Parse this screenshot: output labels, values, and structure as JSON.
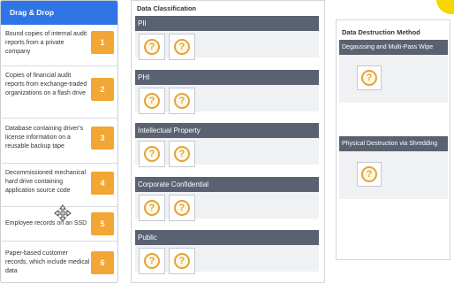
{
  "drag_drop": {
    "title": "Drag & Drop",
    "items": [
      {
        "text": "Bound copies of internal audit reports from a private company",
        "number": "1"
      },
      {
        "text": "Copies of financial audit reports from exchange-traded organizations on a flash drive",
        "number": "2"
      },
      {
        "text": "Database containing driver's license information on a reusable backup tape",
        "number": "3"
      },
      {
        "text": "Decommissioned mechanical hard drive containing application source code",
        "number": "4"
      },
      {
        "text": "Employee records on an SSD",
        "number": "5"
      },
      {
        "text": "Paper-based customer records, which include medical data",
        "number": "6"
      }
    ],
    "badge_color": "#f2a634"
  },
  "classification": {
    "title": "Data Classification",
    "categories": [
      {
        "label": "PII"
      },
      {
        "label": "PHI"
      },
      {
        "label": "Intellectual Property"
      },
      {
        "label": "Corporate Confidential"
      },
      {
        "label": "Public"
      }
    ]
  },
  "destruction": {
    "title": "Data Destruction Method",
    "methods": [
      {
        "label": "Degaussing and Multi-Pass Wipe"
      },
      {
        "label": "Physical Destruction via Shredding"
      }
    ]
  },
  "icons": {
    "placeholder": "question-mark-icon",
    "cursor": "move-cursor-icon"
  },
  "colors": {
    "header_blue": "#2f75e6",
    "bar_gray": "#5a6271",
    "accent_orange": "#e2a33a",
    "corner_yellow": "#f5d600"
  }
}
